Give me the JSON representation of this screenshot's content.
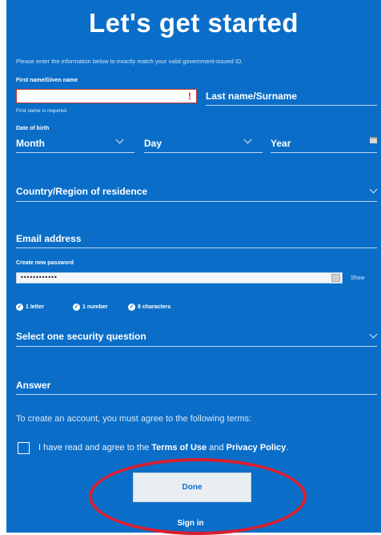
{
  "form": {
    "title": "Let's get started",
    "intro": "Please enter the information below to exactly match your valid government-issued ID.",
    "first_name": {
      "label": "First name/Given name",
      "value": "",
      "error_mark": "!",
      "error": "First name is required."
    },
    "last_name": {
      "label": "Last name/Surname"
    },
    "dob": {
      "label": "Date of birth",
      "month": "Month",
      "day": "Day",
      "year": "Year"
    },
    "country": {
      "label": "Country/Region of residence"
    },
    "email": {
      "label": "Email address"
    },
    "password": {
      "label": "Create new password",
      "masked": "••••••••••••",
      "show": "Show"
    },
    "requirements": [
      "1 letter",
      "1 number",
      "8 characters"
    ],
    "security_question": {
      "label": "Select one security question"
    },
    "answer": {
      "label": "Answer"
    },
    "terms_intro": "To create an account, you must agree to the following terms:",
    "agree": {
      "prefix": "I have read and agree to the ",
      "terms": "Terms of Use",
      "middle": " and ",
      "privacy": "Privacy Policy",
      "suffix": "."
    },
    "done_label": "Done",
    "sign_in_label": "Sign in"
  },
  "colors": {
    "background": "#0a6ec8",
    "highlight": "#d81e2e",
    "error": "#e02020"
  },
  "icons": [
    "chevron-down-icon",
    "calendar-icon",
    "eye-icon",
    "check-icon",
    "error-icon"
  ]
}
